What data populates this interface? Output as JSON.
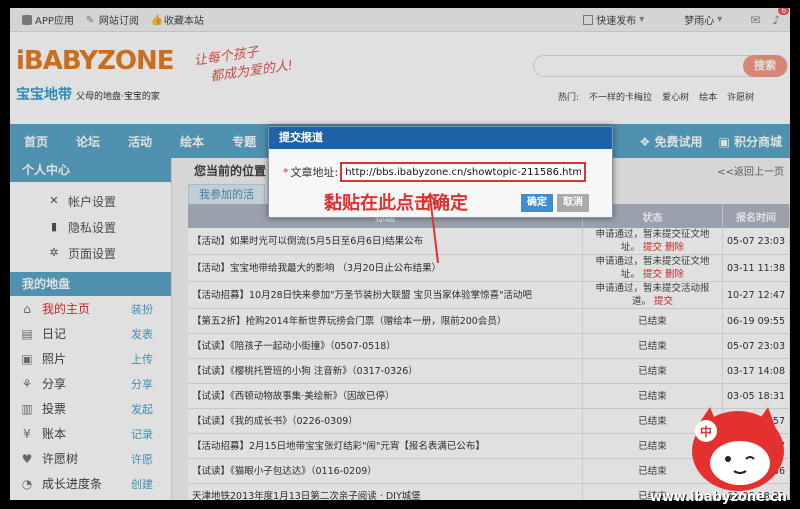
{
  "topbar": {
    "app": "APP应用",
    "subscribe": "网站订阅",
    "favorite": "收藏本站",
    "quick_post": "快速发布",
    "user": "梦雨心",
    "badge": "6"
  },
  "header": {
    "logo": "iBABYZONE",
    "logo_cn": "宝宝地带",
    "logo_sub": "父母的地盘·宝宝的家",
    "slogan_1": "让每个孩子",
    "slogan_2": "都成为爱的人!",
    "search_label": "搜索",
    "hot_label": "热门:",
    "hot_items": [
      "不一样的卡梅拉",
      "爱心树",
      "绘本",
      "许愿树"
    ]
  },
  "nav": {
    "items": [
      "首页",
      "论坛",
      "活动",
      "绘本",
      "专题"
    ],
    "right": [
      "免费试用",
      "积分商城"
    ]
  },
  "sidebar": {
    "personal_center": "个人中心",
    "settings": [
      "帐户设置",
      "隐私设置",
      "页面设置"
    ],
    "my_area": "我的地盘",
    "rows": [
      {
        "label": "我的主页",
        "action": "装扮",
        "icon": "home-icon",
        "glyph": "⌂"
      },
      {
        "label": "日记",
        "action": "发表",
        "icon": "diary-icon",
        "glyph": "▤"
      },
      {
        "label": "照片",
        "action": "上传",
        "icon": "photo-icon",
        "glyph": "▣"
      },
      {
        "label": "分享",
        "action": "分享",
        "icon": "share-icon",
        "glyph": "⚘"
      },
      {
        "label": "投票",
        "action": "发起",
        "icon": "vote-icon",
        "glyph": "▥"
      },
      {
        "label": "账本",
        "action": "记录",
        "icon": "ledger-icon",
        "glyph": "¥"
      },
      {
        "label": "许愿树",
        "action": "许愿",
        "icon": "heart-icon",
        "glyph": "♥"
      },
      {
        "label": "成长进度条",
        "action": "创建",
        "icon": "progress-icon",
        "glyph": "◔"
      }
    ]
  },
  "main": {
    "crumb": "您当前的位置",
    "back": "<<返回上一页",
    "tab": "我参加的活",
    "headers": {
      "title": "标题",
      "status": "状态",
      "time": "报名时间"
    },
    "rows": [
      {
        "title": "【活动】如果时光可以倒流(5月5日至6月6日)结果公布",
        "status": "申请通过，暂未提交征文地址。",
        "links": [
          "提交",
          "删除"
        ],
        "time": "05-07 23:03"
      },
      {
        "title": "【活动】宝宝地带给我最大的影响 （3月20日止公布结果）",
        "status": "申请通过，暂未提交征文地址。",
        "links": [
          "提交",
          "删除"
        ],
        "time": "03-11 11:38"
      },
      {
        "title": "【活动招募】10月28日快来参加\"万圣节装扮大联盟 宝贝当家体验掌惊喜\"活动吧",
        "status": "申请通过，暂未提交活动报道。",
        "links": [
          "提交"
        ],
        "time": "10-27 12:47"
      },
      {
        "title": "【第五2折】抢购2014年新世界玩捞会门票（赠绘本一册，限前200会员）",
        "status": "已结束",
        "links": [],
        "time": "06-19 09:55"
      },
      {
        "title": "【试读】《陪孩子一起动小街撞》（0507-0518）",
        "status": "已结束",
        "links": [],
        "time": "05-07 23:03"
      },
      {
        "title": "【试读】《樱桃托管班的小狗 注音新》（0317-0326）",
        "status": "已结束",
        "links": [],
        "time": "03-17 14:08"
      },
      {
        "title": "【试读】《西顿动物故事集·美绘新》（因故已停）",
        "status": "已结束",
        "links": [],
        "time": "03-05 18:31"
      },
      {
        "title": "【试读】《我的成长书》（0226-0309）",
        "status": "已结束",
        "links": [],
        "time": "02-26 16:57"
      },
      {
        "title": "【活动招募】2月15日地带宝宝张灯结彩\"闹\"元宵【报名表满已公布】",
        "status": "已结束",
        "links": [],
        "time": "02-09 14:27"
      },
      {
        "title": "【试读】《猫眼小子包达达》（0116-0209）",
        "status": "已结束",
        "links": [],
        "time": "01-16 10:36"
      },
      {
        "title": "天津地铁2013年度1月13日第二次亲子阅读 · DIY城堡",
        "status": "已结束",
        "links": [],
        "time": "01-08 18:21"
      }
    ]
  },
  "dialog": {
    "title": "提交报道",
    "field_label": "文章地址:",
    "required_mark": "*",
    "url_value": "http://bbs.ibabyzone.cn/showtopic-211586.html",
    "hint": "黏贴在此点击确定",
    "ok": "确定",
    "cancel": "取消"
  },
  "mascot_char": "中",
  "watermark": "www.ibabyzone.cn"
}
